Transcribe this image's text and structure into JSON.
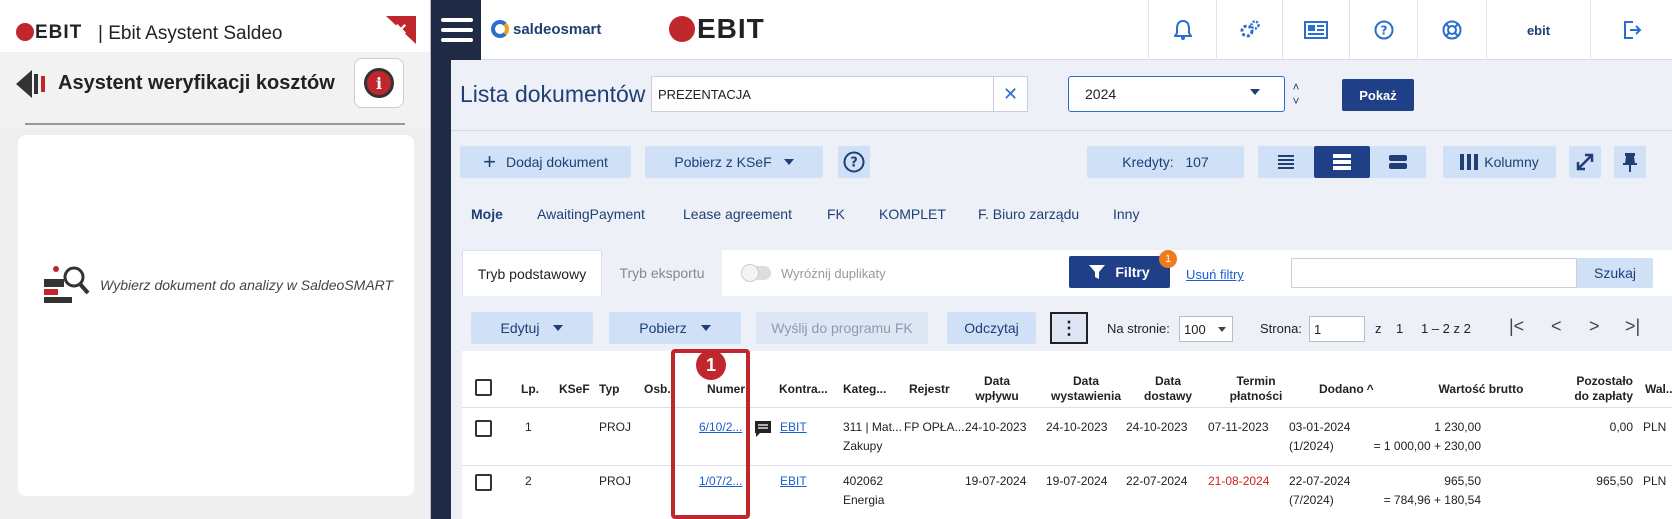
{
  "left_panel": {
    "brand": "EBIT",
    "title": "| Ebit Asystent Saldeo",
    "subtitle": "Asystent weryfikacji kosztów",
    "empty_message": "Wybierz dokument do analizy w SaldeoSMART"
  },
  "topbar": {
    "saldeo_logo": "saldeosmart",
    "ebit_logo": "EBIT",
    "user": "ebit",
    "icons": [
      "bell-icon",
      "gears-icon",
      "news-icon",
      "help-icon",
      "lifebuoy-icon",
      "logout-icon"
    ]
  },
  "header": {
    "title": "Lista dokumentów",
    "company_value": "PREZENTACJA",
    "year_value": "2024",
    "show_button": "Pokaż"
  },
  "toolbar": {
    "add_document": "Dodaj dokument",
    "fetch_ksef": "Pobierz z KSeF",
    "credits_label": "Kredyty:",
    "credits_value": "107",
    "columns": "Kolumny"
  },
  "tabs": [
    "Moje",
    "AwaitingPayment",
    "Lease agreement",
    "FK",
    "KOMPLET",
    "F. Biuro zarządu",
    "Inny"
  ],
  "mode_tabs": {
    "basic": "Tryb podstawowy",
    "export": "Tryb eksportu",
    "duplicates": "Wyróżnij duplikaty"
  },
  "filters": {
    "filters_button": "Filtry",
    "filters_badge": "1",
    "clear": "Usuń filtry",
    "search_button": "Szukaj",
    "search_value": ""
  },
  "actions": {
    "edit": "Edytuj",
    "download": "Pobierz",
    "send_fk": "Wyślij do programu FK",
    "read": "Odczytaj",
    "per_page_label": "Na stronie:",
    "per_page_value": "100",
    "page_label": "Strona:",
    "page_value": "1",
    "page_of": "z",
    "page_total": "1",
    "range": "1 – 2 z 2"
  },
  "annotation": {
    "number": "1",
    "color": "#c0272d"
  },
  "table": {
    "headers": {
      "lp": "Lp.",
      "ksef": "KSeF",
      "typ": "Typ",
      "osb": "Osb.",
      "numer": "Numer",
      "kontra": "Kontra...",
      "kateg": "Kateg...",
      "rejestr": "Rejestr",
      "data_wplywu": "Data wpływu",
      "data_wyst": "Data wystawienia",
      "data_dost": "Data dostawy",
      "termin": "Termin płatności",
      "dodano": "Dodano",
      "wartosc": "Wartość brutto",
      "pozostalo": "Pozostało do zapłaty",
      "waluta": "Wal..."
    },
    "rows": [
      {
        "lp": "1",
        "typ": "PROJ",
        "numer": "6/10/2...",
        "kontra": "EBIT",
        "kateg1": "311 | Mat...",
        "kateg2": "Zakupy",
        "rejestr": "FP OPŁA...",
        "data_wplywu": "24-10-2023",
        "data_wyst": "24-10-2023",
        "data_dost": "24-10-2023",
        "termin": "07-11-2023",
        "dodano1": "03-01-2024",
        "dodano2": "(1/2024)",
        "wartosc1": "1 230,00",
        "wartosc2": "= 1 000,00 + 230,00",
        "pozostalo": "0,00",
        "waluta": "PLN"
      },
      {
        "lp": "2",
        "typ": "PROJ",
        "numer": "1/07/2...",
        "kontra": "EBIT",
        "kateg1": "402062",
        "kateg2": "Energia",
        "rejestr": "",
        "data_wplywu": "19-07-2024",
        "data_wyst": "19-07-2024",
        "data_dost": "22-07-2024",
        "termin": "21-08-2024",
        "dodano1": "22-07-2024",
        "dodano2": "(7/2024)",
        "wartosc1": "965,50",
        "wartosc2": "= 784,96 + 180,54",
        "pozostalo": "965,50",
        "waluta": "PLN"
      }
    ]
  }
}
